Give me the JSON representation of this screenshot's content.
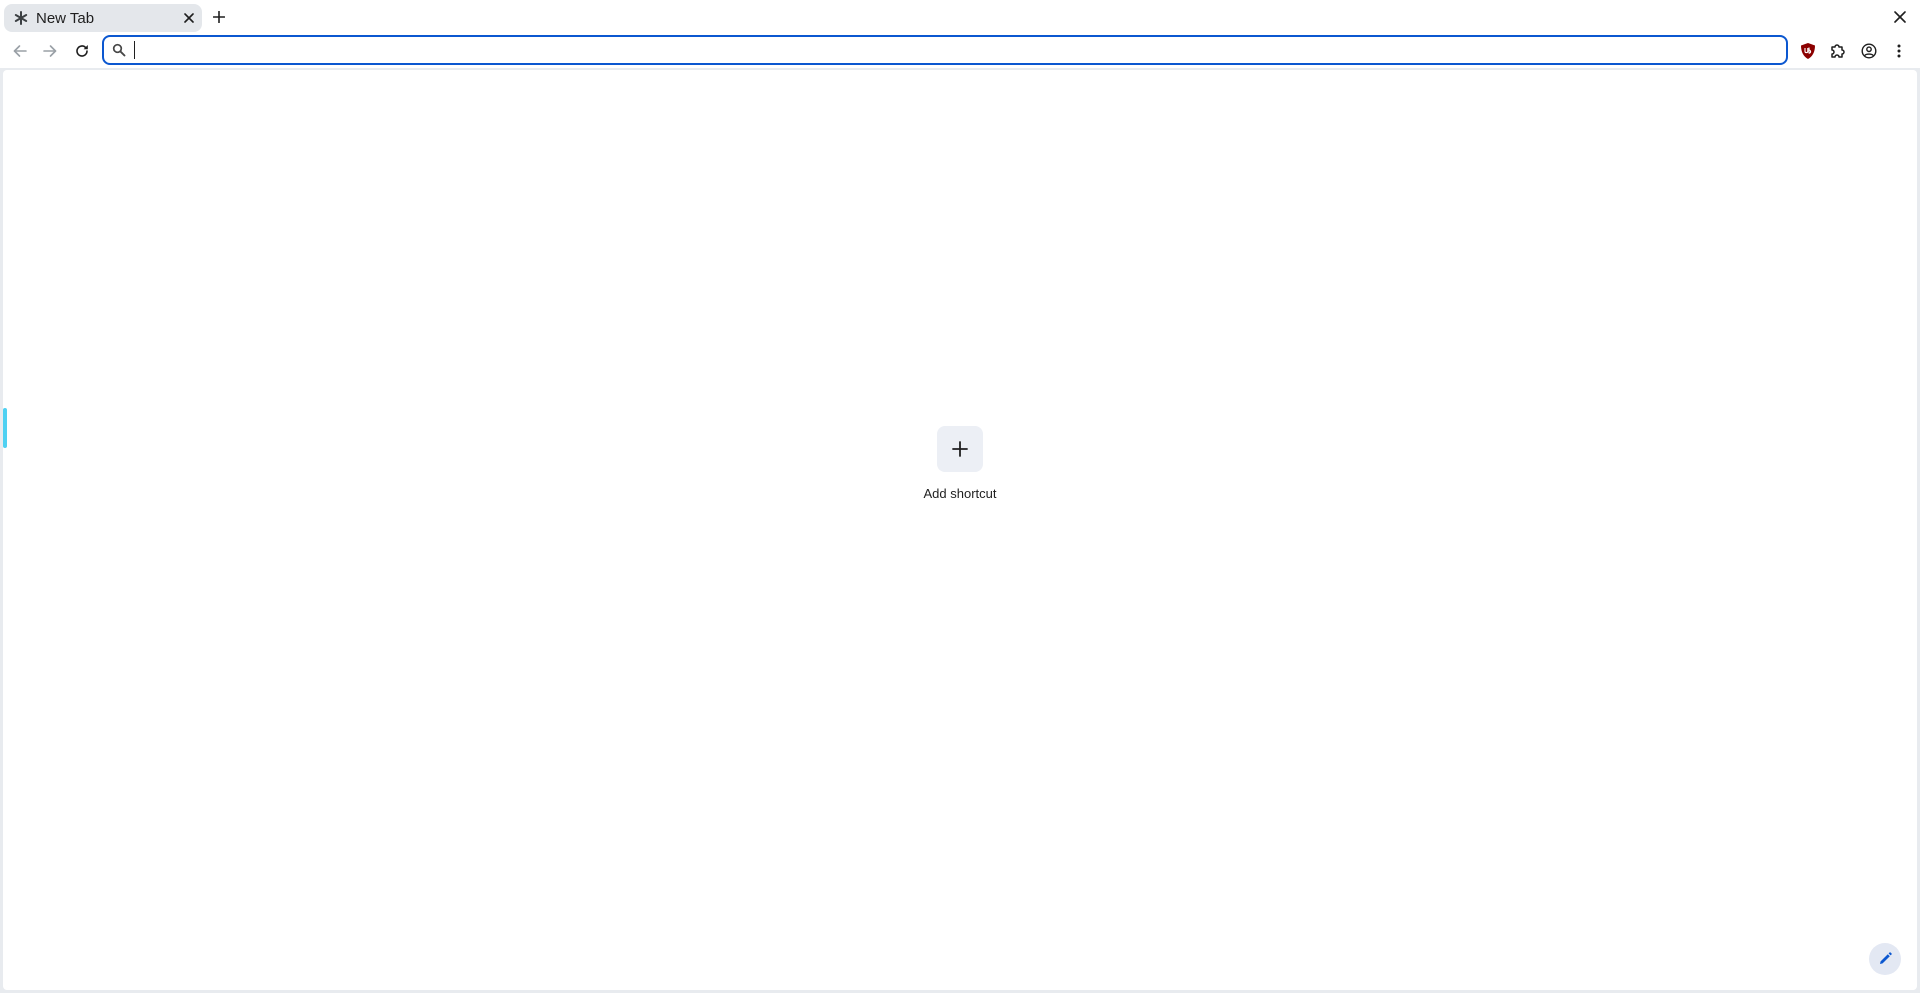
{
  "tab": {
    "title": "New Tab",
    "favicon": "asterisk-icon",
    "close_icon": "close-icon"
  },
  "tabstrip": {
    "new_tab_icon": "plus-icon",
    "window_close_icon": "close-icon"
  },
  "toolbar": {
    "back_icon": "arrow-left-icon",
    "forward_icon": "arrow-right-icon",
    "reload_icon": "reload-icon",
    "omnibox": {
      "value": "",
      "placeholder": "",
      "icon": "search-icon"
    },
    "extensions": [
      {
        "name": "ublock-origin-icon"
      },
      {
        "name": "extensions-puzzle-icon"
      },
      {
        "name": "profile-icon"
      },
      {
        "name": "menu-kebab-icon"
      }
    ]
  },
  "content": {
    "shortcut": {
      "label": "Add shortcut",
      "icon": "plus-icon"
    },
    "customize_icon": "pencil-icon"
  },
  "colors": {
    "omnibox_border": "#0b57d0",
    "tab_active_bg": "#e4e7eb",
    "shortcut_tile_bg": "#eceff5",
    "customize_bg": "#e3e8f3",
    "side_handle": "#4fd1f2",
    "ublock_red": "#8b0000"
  }
}
